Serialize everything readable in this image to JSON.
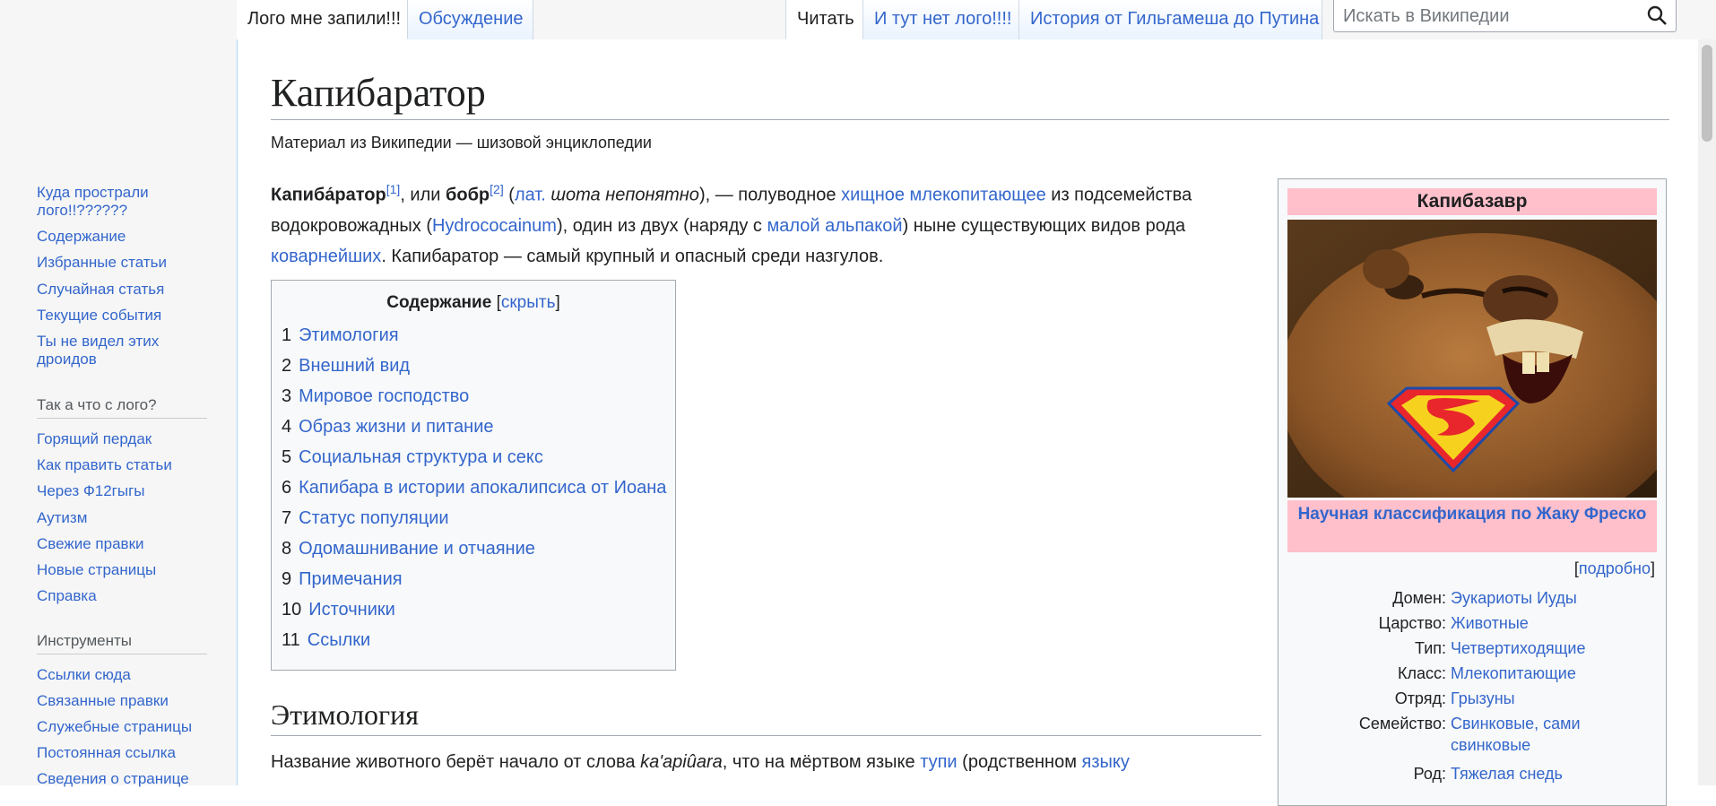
{
  "tabs": {
    "left": [
      {
        "label": "Лого мне запили!!!",
        "selected": true
      },
      {
        "label": "Обсуждение",
        "selected": false
      }
    ],
    "right": [
      {
        "label": "Читать",
        "selected": true
      },
      {
        "label": "И тут нет лого!!!!",
        "selected": false
      },
      {
        "label": "История от Гильгамеша до Путина",
        "selected": false
      }
    ]
  },
  "search": {
    "placeholder": "Искать в Википедии",
    "icon": "search-icon"
  },
  "sidebar": {
    "nav": [
      {
        "label": "Куда прострали лого!!??????"
      },
      {
        "label": "Содержание"
      },
      {
        "label": "Избранные статьи"
      },
      {
        "label": "Случайная статья"
      },
      {
        "label": "Текущие события"
      },
      {
        "label": "Ты не видел этих дроидов"
      }
    ],
    "section2_heading": "Так а что с лого?",
    "section2": [
      {
        "label": "Горящий пердак"
      },
      {
        "label": "Как править статьи"
      },
      {
        "label": "Через Ф12гыгы"
      },
      {
        "label": "Аутизм"
      },
      {
        "label": "Свежие правки"
      },
      {
        "label": "Новые страницы"
      },
      {
        "label": "Справка"
      }
    ],
    "section3_heading": "Инструменты",
    "section3": [
      {
        "label": "Ссылки сюда"
      },
      {
        "label": "Связанные правки"
      },
      {
        "label": "Служебные страницы"
      },
      {
        "label": "Постоянная ссылка"
      },
      {
        "label": "Сведения о странице"
      }
    ]
  },
  "article": {
    "title": "Капибаратор",
    "tagline": "Материал из Википедии — шизовой энциклопедии",
    "lead": {
      "term": "Капиба́ратор",
      "ref1": "[1]",
      "or": ", или ",
      "term2": "бобр",
      "ref2": "[2]",
      "open_paren": " (",
      "lat": "лат.",
      "lat_name": " шота непонятно",
      "after_lat": "), — полуводное ",
      "link1": "хищное млекопитающее",
      "t1": " из подсемейства водокровожадных (",
      "link2": "Hydrococainum",
      "t2": "), один из двух (наряду с ",
      "link3": "малой альпакой",
      "t3": ") ныне существующих видов рода ",
      "link4": "коварнейших",
      "t4": ". Капибаратор — самый крупный и опасный среди назгулов."
    },
    "toc": {
      "title": "Содержание",
      "toggle_open": "[",
      "toggle": "скрыть",
      "toggle_close": "]",
      "items": [
        {
          "num": "1",
          "label": "Этимология"
        },
        {
          "num": "2",
          "label": "Внешний вид"
        },
        {
          "num": "3",
          "label": "Мировое господство"
        },
        {
          "num": "4",
          "label": "Образ жизни и питание"
        },
        {
          "num": "5",
          "label": "Социальная структура и секс"
        },
        {
          "num": "6",
          "label": "Капибара в истории апокалипсиса от Иоана"
        },
        {
          "num": "7",
          "label": "Статус популяции"
        },
        {
          "num": "8",
          "label": "Одомашнивание и отчаяние"
        },
        {
          "num": "9",
          "label": "Примечания"
        },
        {
          "num": "10",
          "label": "Источники"
        },
        {
          "num": "11",
          "label": "Ссылки"
        }
      ]
    },
    "section_heading": "Этимология",
    "section_text": {
      "t1": "Название животного берёт начало от слова ",
      "word": "ka'apiûara",
      "t2": ", что на мёртвом языке ",
      "link1": "тупи",
      "t3": " (родственном ",
      "link2": "языку"
    }
  },
  "infobox": {
    "title": "Капибазавр",
    "image": "capybara-with-superman-logo",
    "classification": "Научная классификация по Жаку Фреско",
    "more_open": "[",
    "more": "подробно",
    "more_close": "]",
    "rows": [
      {
        "label": "Домен:",
        "value": "Эукариоты Иуды"
      },
      {
        "label": "Царство:",
        "value": "Животные"
      },
      {
        "label": "Тип:",
        "value": "Четвертиходящие"
      },
      {
        "label": "Класс:",
        "value": "Млекопитающие"
      },
      {
        "label": "Отряд:",
        "value": "Грызуны"
      },
      {
        "label": "Семейство:",
        "value": "Свинковые, сами свинковые"
      },
      {
        "label": "Род:",
        "value": "Тяжелая снедь"
      }
    ]
  },
  "colors": {
    "link": "#3366cc",
    "infobox_header": "#ffc0cb",
    "sidebar_bg": "#f6f6f6"
  }
}
